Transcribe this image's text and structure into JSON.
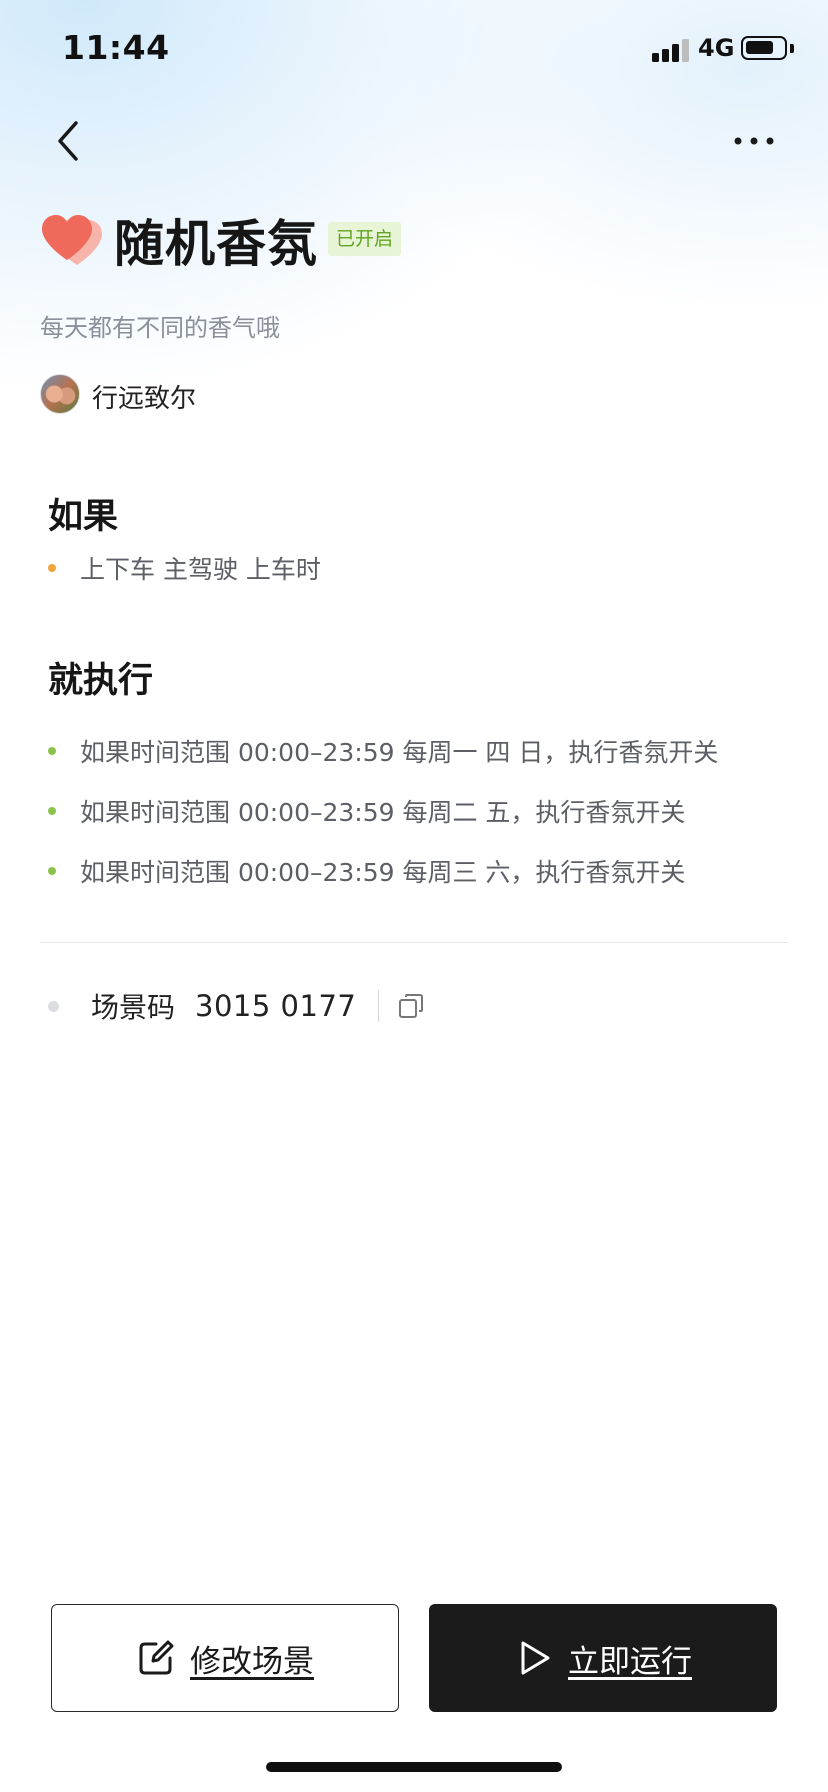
{
  "status_bar": {
    "time": "11:44",
    "network": "4G",
    "signal_icon": "cellular-signal-icon",
    "battery_icon": "battery-icon"
  },
  "nav": {
    "back_icon": "chevron-left-icon",
    "more_icon": "more-horizontal-icon"
  },
  "scene": {
    "icon": "heart-icon",
    "title": "随机香氛",
    "status": "已开启",
    "description": "每天都有不同的香气哦",
    "author": "行远致尔"
  },
  "if_section": {
    "heading": "如果",
    "items": [
      {
        "text": "上下车 主驾驶 上车时",
        "dot_color": "#f0a43a"
      }
    ]
  },
  "then_section": {
    "heading": "就执行",
    "items": [
      {
        "text": "如果时间范围  00:00–23:59 每周一 四 日，执行香氛开关",
        "dot_color": "#8bc34a"
      },
      {
        "text": "如果时间范围  00:00–23:59 每周二 五，执行香氛开关",
        "dot_color": "#8bc34a"
      },
      {
        "text": "如果时间范围  00:00–23:59 每周三 六，执行香氛开关",
        "dot_color": "#8bc34a"
      }
    ]
  },
  "scene_code": {
    "label": "场景码",
    "value": "3015 0177",
    "copy_icon": "copy-icon"
  },
  "actions": {
    "edit_label": "修改场景",
    "edit_icon": "edit-icon",
    "run_label": "立即运行",
    "run_icon": "play-icon"
  },
  "colors": {
    "badge_text": "#5fa51f",
    "badge_bg": "#e8f4d6",
    "heart": "#ef6a5a",
    "run_button_bg": "#1b1b1b"
  }
}
